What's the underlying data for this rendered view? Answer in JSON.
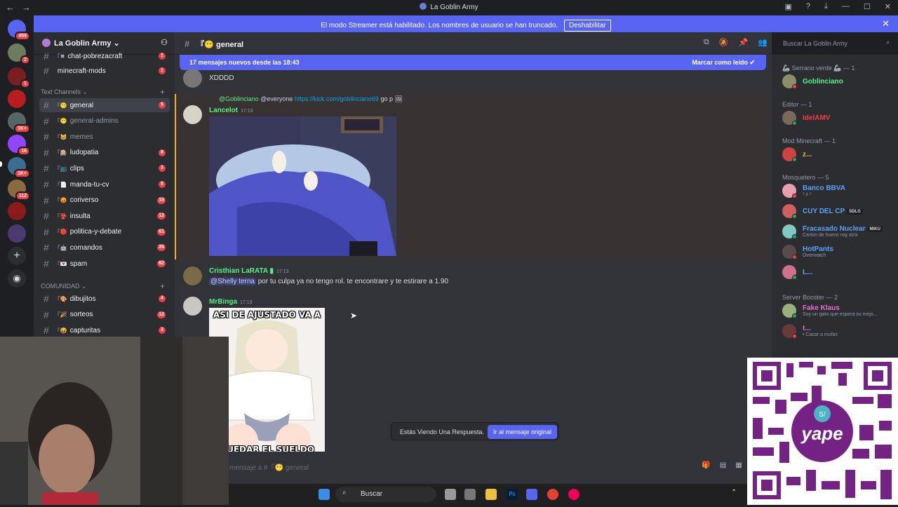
{
  "window": {
    "title": "La Goblin Army"
  },
  "banner": {
    "text": "El modo Streamer está habilitado. Los nombres de usuario se han truncado.",
    "button": "Deshabilitar"
  },
  "guilds": {
    "badges": [
      "459",
      "1",
      "1K+",
      "16",
      "1K+",
      "112"
    ]
  },
  "server": {
    "name": "La Goblin Army"
  },
  "channels": {
    "top": [
      {
        "emoji": "『✖",
        "label": "chat-pobrezacraft",
        "badge": "1"
      },
      {
        "emoji": "",
        "label": "minecraft-mods",
        "badge": "1"
      }
    ],
    "cat_text": "Text Channels",
    "text_list": [
      {
        "emoji": "『😶",
        "label": "general",
        "badge": "5"
      },
      {
        "emoji": "『😶",
        "label": "general-admins",
        "badge": ""
      },
      {
        "emoji": "『🐱",
        "label": "memes",
        "badge": ""
      },
      {
        "emoji": "『🎰",
        "label": "ludopatia",
        "badge": "8"
      },
      {
        "emoji": "『📺",
        "label": "clips",
        "badge": "3"
      },
      {
        "emoji": "『📄",
        "label": "manda-tu-cv",
        "badge": "5"
      },
      {
        "emoji": "『😡",
        "label": "coriverso",
        "badge": "10"
      },
      {
        "emoji": "『👺",
        "label": "insulta",
        "badge": "12"
      },
      {
        "emoji": "『🔴",
        "label": "politica-y-debate",
        "badge": "61"
      },
      {
        "emoji": "『🤖",
        "label": "comandos",
        "badge": "26"
      },
      {
        "emoji": "『💌",
        "label": "spam",
        "badge": "62"
      }
    ],
    "cat_community": "COMUNIDAD",
    "community_list": [
      {
        "emoji": "『🎨",
        "label": "dibujitos",
        "badge": "4"
      },
      {
        "emoji": "『🎉",
        "label": "sorteos",
        "badge": "12"
      },
      {
        "emoji": "『😝",
        "label": "capturitas",
        "badge": "3"
      }
    ]
  },
  "chat": {
    "channel": "『😶 general",
    "new_messages": "17 mensajes nuevos desde las 18:43",
    "mark_read": "Marcar como leído",
    "messages": [
      {
        "text": "XDDDD"
      },
      {
        "reply_mention": "@Goblinciano",
        "reply_everyone": "@everyone",
        "reply_link": "https://kick.com/goblinciano69",
        "reply_tail": "go p",
        "user": "Lancelot",
        "time": "17:13",
        "color": "#57f287"
      },
      {
        "user": "Cristhian LaRATA",
        "time": "17:13",
        "color": "#57f287",
        "mention": "@Shelly terna",
        "text": "por tu culpa ya no tengo rol. te encontrare y te estirare a 1.90"
      },
      {
        "user": "MrBinga",
        "time": "17:13",
        "color": "#57f287",
        "meme_top": "ASI DE AJUSTADO VA A",
        "meme_bottom": "QUEDAR EL SUELDO"
      }
    ],
    "reply_notice": "Estás Viendo Una Respuesta.",
    "reply_button": "Ir al mensaje original",
    "composer_placeholder": "mensaje a #『😶 general"
  },
  "members": {
    "search_placeholder": "Buscar La Goblin Army",
    "groups": [
      {
        "role": "🦾 Serrano verde 🦾 — 1",
        "members": [
          {
            "name": "Goblinciano",
            "color": "#57f287",
            "sub": "",
            "tag": ""
          }
        ]
      },
      {
        "role": "Editor — 1",
        "members": [
          {
            "name": "IdelAMV",
            "color": "#f23f43",
            "sub": "",
            "tag": ""
          }
        ]
      },
      {
        "role": "Mod Minecraft — 1",
        "members": [
          {
            "name": "z...",
            "color": "#f0b232",
            "sub": "",
            "tag": ""
          }
        ]
      },
      {
        "role": "Mosquetero — 5",
        "members": [
          {
            "name": "Banco BBVA",
            "color": "#5da3f5",
            "sub": "ᶻ z ᶻ",
            "tag": ""
          },
          {
            "name": "CUY DEL CP",
            "color": "#5da3f5",
            "sub": "",
            "tag": "SDLG"
          },
          {
            "name": "Fracasado Nuclear",
            "color": "#5da3f5",
            "sub": "Carton de huevo rog strix",
            "tag": "MIKU"
          },
          {
            "name": "HotPants",
            "color": "#5da3f5",
            "sub": "Overwatch",
            "tag": ""
          },
          {
            "name": "L...",
            "color": "#5da3f5",
            "sub": "",
            "tag": ""
          }
        ]
      },
      {
        "role": "Server Booster — 2",
        "members": [
          {
            "name": "Fake Klaus",
            "color": "#eb6fd0",
            "sub": "Soy un gato que espera su mejo...",
            "tag": ""
          },
          {
            "name": "t...",
            "color": "#eb6fd0",
            "sub": "• Cazar a mufas",
            "tag": ""
          }
        ]
      }
    ]
  },
  "taskbar": {
    "search": "Buscar"
  }
}
